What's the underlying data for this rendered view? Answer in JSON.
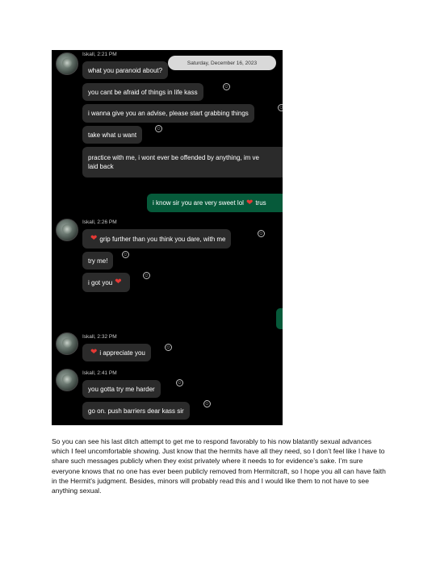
{
  "chat": {
    "date_pill": "Saturday, December 16, 2023",
    "groups": [
      {
        "meta": "Iskall, 2:21 PM"
      },
      {
        "meta": "Iskall, 2:26 PM"
      },
      {
        "meta": "Iskall, 2:32 PM"
      },
      {
        "meta": "Iskall, 2:41 PM"
      }
    ],
    "messages": {
      "m1": "what you paranoid about?",
      "m2": "you cant be afraid of things in life kass",
      "m3": "i wanna give you an advise, please start grabbing things",
      "m4": "take what u want",
      "m5a": "practice with me, i wont ever be offended by anything, im ve",
      "m5b": "laid back",
      "out1a": "i know sir you are very sweet lol",
      "out1b": "trus",
      "m6": "grip further than you think you dare, with me",
      "m7": "try me!",
      "m8": "i got you",
      "m9": "i appreciate you",
      "m10": "you gotta try me harder",
      "m11": "go on. push barriers dear kass sir"
    },
    "reaction_icon": "add-reaction-icon",
    "heart_icon": "red-heart-emoji"
  },
  "paragraph": "So you can see his last ditch attempt to get me to respond favorably to his now blatantly sexual advances which I feel uncomfortable showing. Just know that the hermits have all they need, so I don’t feel like I have to share such messages publicly when they exist privately where it needs to for evidence’s sake. I’m sure everyone knows that no one has ever been publicly removed from Hermitcraft, so I hope you all can have faith in the Hermit’s judgment. Besides, minors will probably read this and I would like them to not have to see anything sexual.",
  "colors": {
    "chat_bg": "#000000",
    "incoming_bubble": "#2b2b2b",
    "outgoing_bubble": "#065a3a",
    "heart": "#e53935"
  }
}
